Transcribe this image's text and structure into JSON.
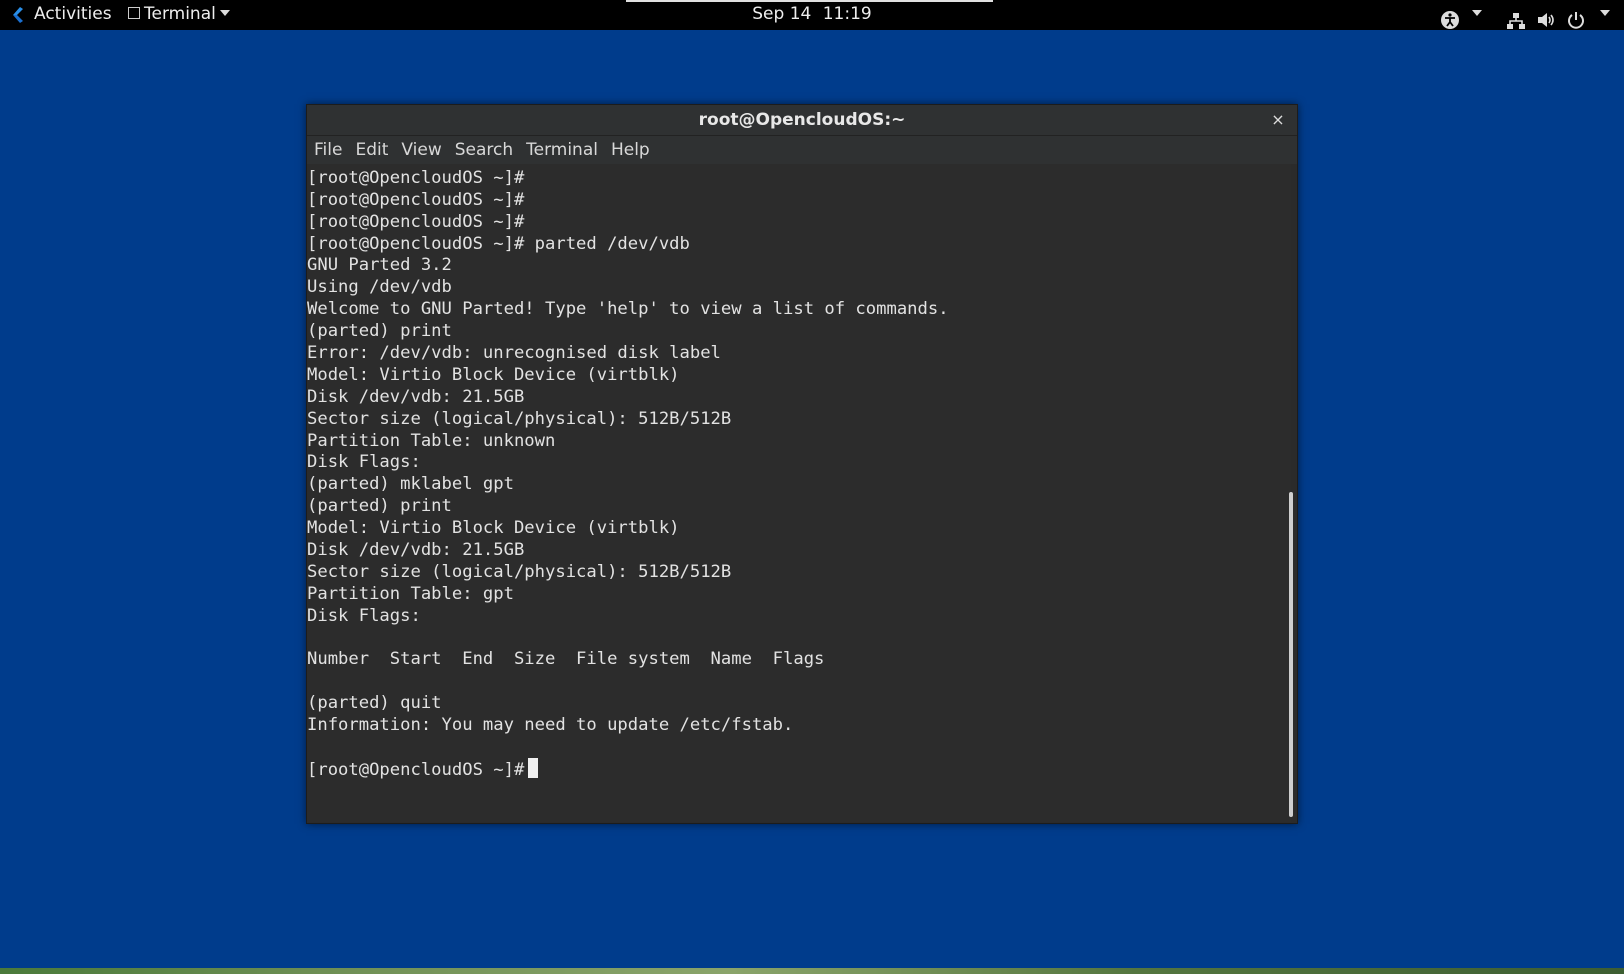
{
  "topbar": {
    "activities": "Activities",
    "app_menu": "Terminal",
    "clock_date": "Sep 14",
    "clock_time": "11:19",
    "tray_icons": [
      "accessibility-icon",
      "network-icon",
      "volume-icon",
      "power-icon"
    ]
  },
  "window": {
    "title": "root@OpencloudOS:~",
    "close": "×",
    "menu": [
      "File",
      "Edit",
      "View",
      "Search",
      "Terminal",
      "Help"
    ]
  },
  "terminal": {
    "lines": [
      "[root@OpencloudOS ~]#",
      "[root@OpencloudOS ~]#",
      "[root@OpencloudOS ~]#",
      "[root@OpencloudOS ~]# parted /dev/vdb",
      "GNU Parted 3.2",
      "Using /dev/vdb",
      "Welcome to GNU Parted! Type 'help' to view a list of commands.",
      "(parted) print",
      "Error: /dev/vdb: unrecognised disk label",
      "Model: Virtio Block Device (virtblk)",
      "Disk /dev/vdb: 21.5GB",
      "Sector size (logical/physical): 512B/512B",
      "Partition Table: unknown",
      "Disk Flags:",
      "(parted) mklabel gpt",
      "(parted) print",
      "Model: Virtio Block Device (virtblk)",
      "Disk /dev/vdb: 21.5GB",
      "Sector size (logical/physical): 512B/512B",
      "Partition Table: gpt",
      "Disk Flags:",
      "",
      "Number  Start  End  Size  File system  Name  Flags",
      "",
      "(parted) quit",
      "Information: You may need to update /etc/fstab.",
      "",
      "[root@OpencloudOS ~]#"
    ]
  },
  "colors": {
    "desktop": "#003c8c",
    "topbar": "#000000",
    "terminal_bg": "#2c2c2c",
    "terminal_fg": "#e2e2e2"
  }
}
